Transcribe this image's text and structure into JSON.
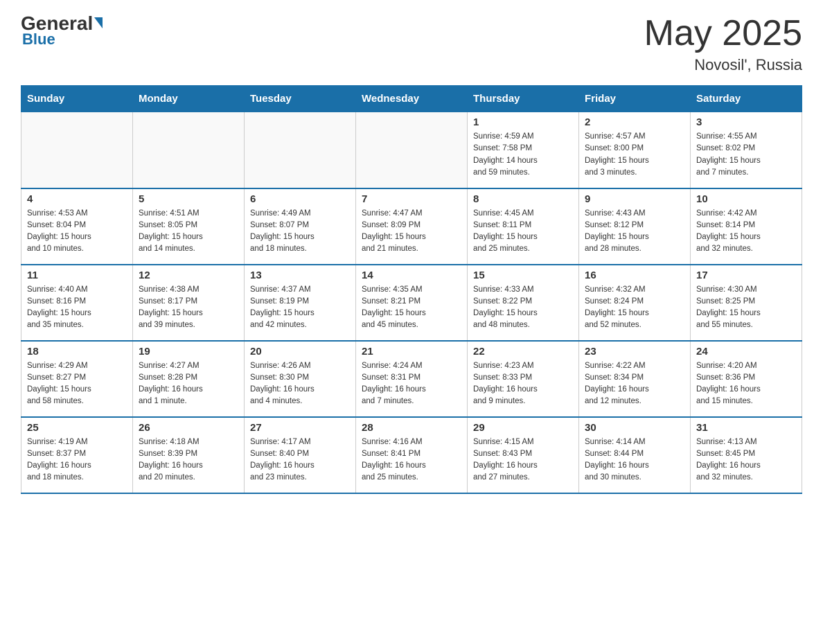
{
  "header": {
    "logo": {
      "general": "General",
      "blue": "Blue",
      "underline": "Blue"
    },
    "title": "May 2025",
    "location": "Novosil', Russia"
  },
  "weekdays": [
    "Sunday",
    "Monday",
    "Tuesday",
    "Wednesday",
    "Thursday",
    "Friday",
    "Saturday"
  ],
  "weeks": [
    [
      {
        "day": "",
        "info": ""
      },
      {
        "day": "",
        "info": ""
      },
      {
        "day": "",
        "info": ""
      },
      {
        "day": "",
        "info": ""
      },
      {
        "day": "1",
        "info": "Sunrise: 4:59 AM\nSunset: 7:58 PM\nDaylight: 14 hours\nand 59 minutes."
      },
      {
        "day": "2",
        "info": "Sunrise: 4:57 AM\nSunset: 8:00 PM\nDaylight: 15 hours\nand 3 minutes."
      },
      {
        "day": "3",
        "info": "Sunrise: 4:55 AM\nSunset: 8:02 PM\nDaylight: 15 hours\nand 7 minutes."
      }
    ],
    [
      {
        "day": "4",
        "info": "Sunrise: 4:53 AM\nSunset: 8:04 PM\nDaylight: 15 hours\nand 10 minutes."
      },
      {
        "day": "5",
        "info": "Sunrise: 4:51 AM\nSunset: 8:05 PM\nDaylight: 15 hours\nand 14 minutes."
      },
      {
        "day": "6",
        "info": "Sunrise: 4:49 AM\nSunset: 8:07 PM\nDaylight: 15 hours\nand 18 minutes."
      },
      {
        "day": "7",
        "info": "Sunrise: 4:47 AM\nSunset: 8:09 PM\nDaylight: 15 hours\nand 21 minutes."
      },
      {
        "day": "8",
        "info": "Sunrise: 4:45 AM\nSunset: 8:11 PM\nDaylight: 15 hours\nand 25 minutes."
      },
      {
        "day": "9",
        "info": "Sunrise: 4:43 AM\nSunset: 8:12 PM\nDaylight: 15 hours\nand 28 minutes."
      },
      {
        "day": "10",
        "info": "Sunrise: 4:42 AM\nSunset: 8:14 PM\nDaylight: 15 hours\nand 32 minutes."
      }
    ],
    [
      {
        "day": "11",
        "info": "Sunrise: 4:40 AM\nSunset: 8:16 PM\nDaylight: 15 hours\nand 35 minutes."
      },
      {
        "day": "12",
        "info": "Sunrise: 4:38 AM\nSunset: 8:17 PM\nDaylight: 15 hours\nand 39 minutes."
      },
      {
        "day": "13",
        "info": "Sunrise: 4:37 AM\nSunset: 8:19 PM\nDaylight: 15 hours\nand 42 minutes."
      },
      {
        "day": "14",
        "info": "Sunrise: 4:35 AM\nSunset: 8:21 PM\nDaylight: 15 hours\nand 45 minutes."
      },
      {
        "day": "15",
        "info": "Sunrise: 4:33 AM\nSunset: 8:22 PM\nDaylight: 15 hours\nand 48 minutes."
      },
      {
        "day": "16",
        "info": "Sunrise: 4:32 AM\nSunset: 8:24 PM\nDaylight: 15 hours\nand 52 minutes."
      },
      {
        "day": "17",
        "info": "Sunrise: 4:30 AM\nSunset: 8:25 PM\nDaylight: 15 hours\nand 55 minutes."
      }
    ],
    [
      {
        "day": "18",
        "info": "Sunrise: 4:29 AM\nSunset: 8:27 PM\nDaylight: 15 hours\nand 58 minutes."
      },
      {
        "day": "19",
        "info": "Sunrise: 4:27 AM\nSunset: 8:28 PM\nDaylight: 16 hours\nand 1 minute."
      },
      {
        "day": "20",
        "info": "Sunrise: 4:26 AM\nSunset: 8:30 PM\nDaylight: 16 hours\nand 4 minutes."
      },
      {
        "day": "21",
        "info": "Sunrise: 4:24 AM\nSunset: 8:31 PM\nDaylight: 16 hours\nand 7 minutes."
      },
      {
        "day": "22",
        "info": "Sunrise: 4:23 AM\nSunset: 8:33 PM\nDaylight: 16 hours\nand 9 minutes."
      },
      {
        "day": "23",
        "info": "Sunrise: 4:22 AM\nSunset: 8:34 PM\nDaylight: 16 hours\nand 12 minutes."
      },
      {
        "day": "24",
        "info": "Sunrise: 4:20 AM\nSunset: 8:36 PM\nDaylight: 16 hours\nand 15 minutes."
      }
    ],
    [
      {
        "day": "25",
        "info": "Sunrise: 4:19 AM\nSunset: 8:37 PM\nDaylight: 16 hours\nand 18 minutes."
      },
      {
        "day": "26",
        "info": "Sunrise: 4:18 AM\nSunset: 8:39 PM\nDaylight: 16 hours\nand 20 minutes."
      },
      {
        "day": "27",
        "info": "Sunrise: 4:17 AM\nSunset: 8:40 PM\nDaylight: 16 hours\nand 23 minutes."
      },
      {
        "day": "28",
        "info": "Sunrise: 4:16 AM\nSunset: 8:41 PM\nDaylight: 16 hours\nand 25 minutes."
      },
      {
        "day": "29",
        "info": "Sunrise: 4:15 AM\nSunset: 8:43 PM\nDaylight: 16 hours\nand 27 minutes."
      },
      {
        "day": "30",
        "info": "Sunrise: 4:14 AM\nSunset: 8:44 PM\nDaylight: 16 hours\nand 30 minutes."
      },
      {
        "day": "31",
        "info": "Sunrise: 4:13 AM\nSunset: 8:45 PM\nDaylight: 16 hours\nand 32 minutes."
      }
    ]
  ]
}
